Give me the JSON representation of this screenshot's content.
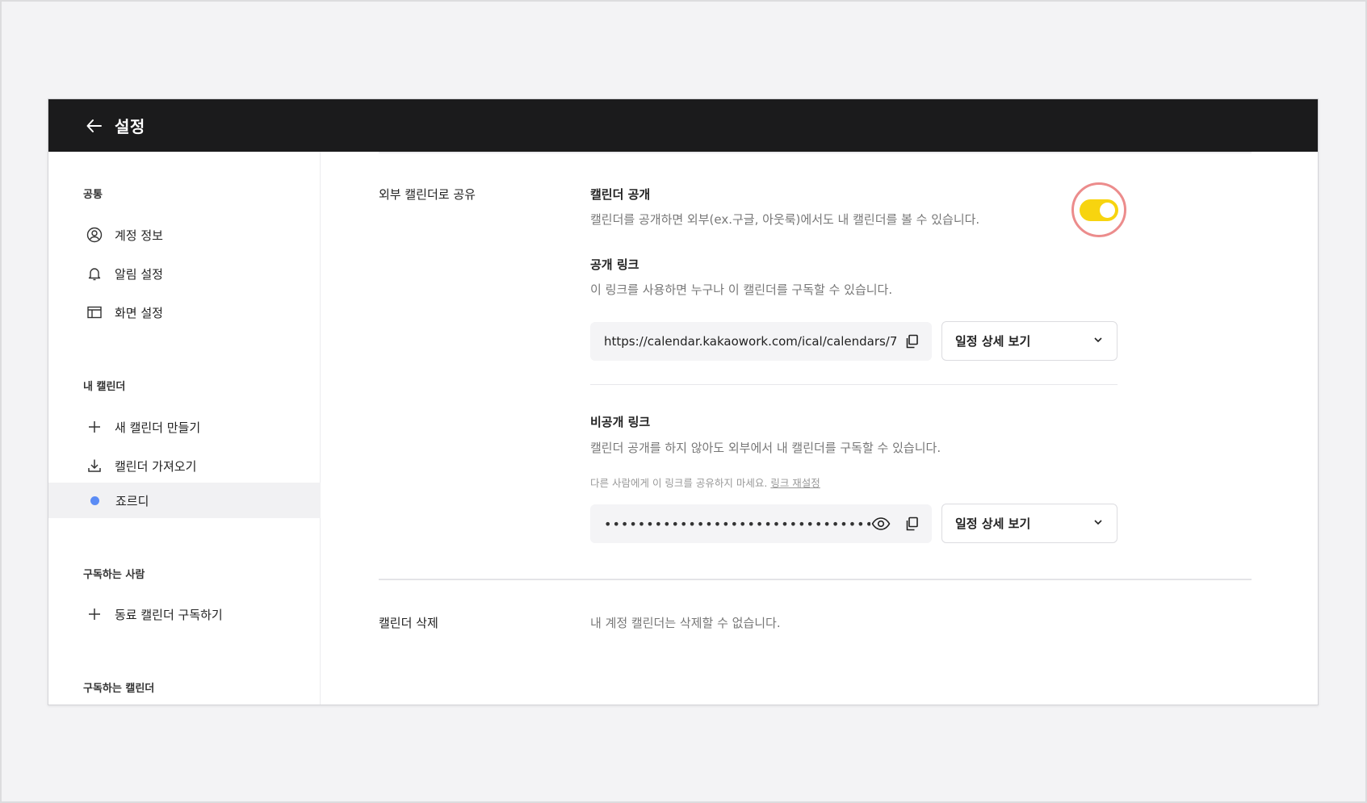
{
  "header": {
    "title": "설정"
  },
  "sidebar": {
    "sections": [
      {
        "title": "공통"
      },
      {
        "title": "내 캘린더"
      },
      {
        "title": "구독하는 사람"
      },
      {
        "title": "구독하는 캘린더"
      }
    ],
    "items": [
      {
        "label": "계정 정보",
        "icon": "user-circle-icon"
      },
      {
        "label": "알림 설정",
        "icon": "bell-icon"
      },
      {
        "label": "화면 설정",
        "icon": "layout-icon"
      },
      {
        "label": "새 캘린더 만들기",
        "icon": "plus-icon"
      },
      {
        "label": "캘린더 가져오기",
        "icon": "download-icon"
      },
      {
        "label": "죠르디",
        "icon": "dot-icon",
        "dot_color": "#5b8cf5",
        "active": true
      },
      {
        "label": "동료 캘린더 구독하기",
        "icon": "plus-icon"
      }
    ]
  },
  "share": {
    "section_label": "외부 캘린더로 공유",
    "public": {
      "title": "캘린더 공개",
      "description": "캘린더를 공개하면 외부(ex.구글, 아웃룩)에서도 내 캘린더를 볼 수 있습니다.",
      "toggle_on": true,
      "toggle_color": "#f7d40f"
    },
    "public_link": {
      "title": "공개 링크",
      "description": "이 링크를 사용하면 누구나 이 캘린더를 구독할 수 있습니다.",
      "url": "https://calendar.kakaowork.com/ical/calendars/7",
      "select_value": "일정 상세 보기"
    },
    "private_link": {
      "title": "비공개 링크",
      "description": "캘린더 공개를 하지 않아도 외부에서 내 캘린더를 구독할 수 있습니다.",
      "warning": "다른 사람에게 이 링크를 공유하지 마세요.",
      "reset_link": "링크 재설정",
      "masked_value": "••••••••••••••••••••••••••••••••••••••",
      "select_value": "일정 상세 보기"
    }
  },
  "delete": {
    "label": "캘린더 삭제",
    "description": "내 계정 캘린더는 삭제할 수 없습니다."
  }
}
